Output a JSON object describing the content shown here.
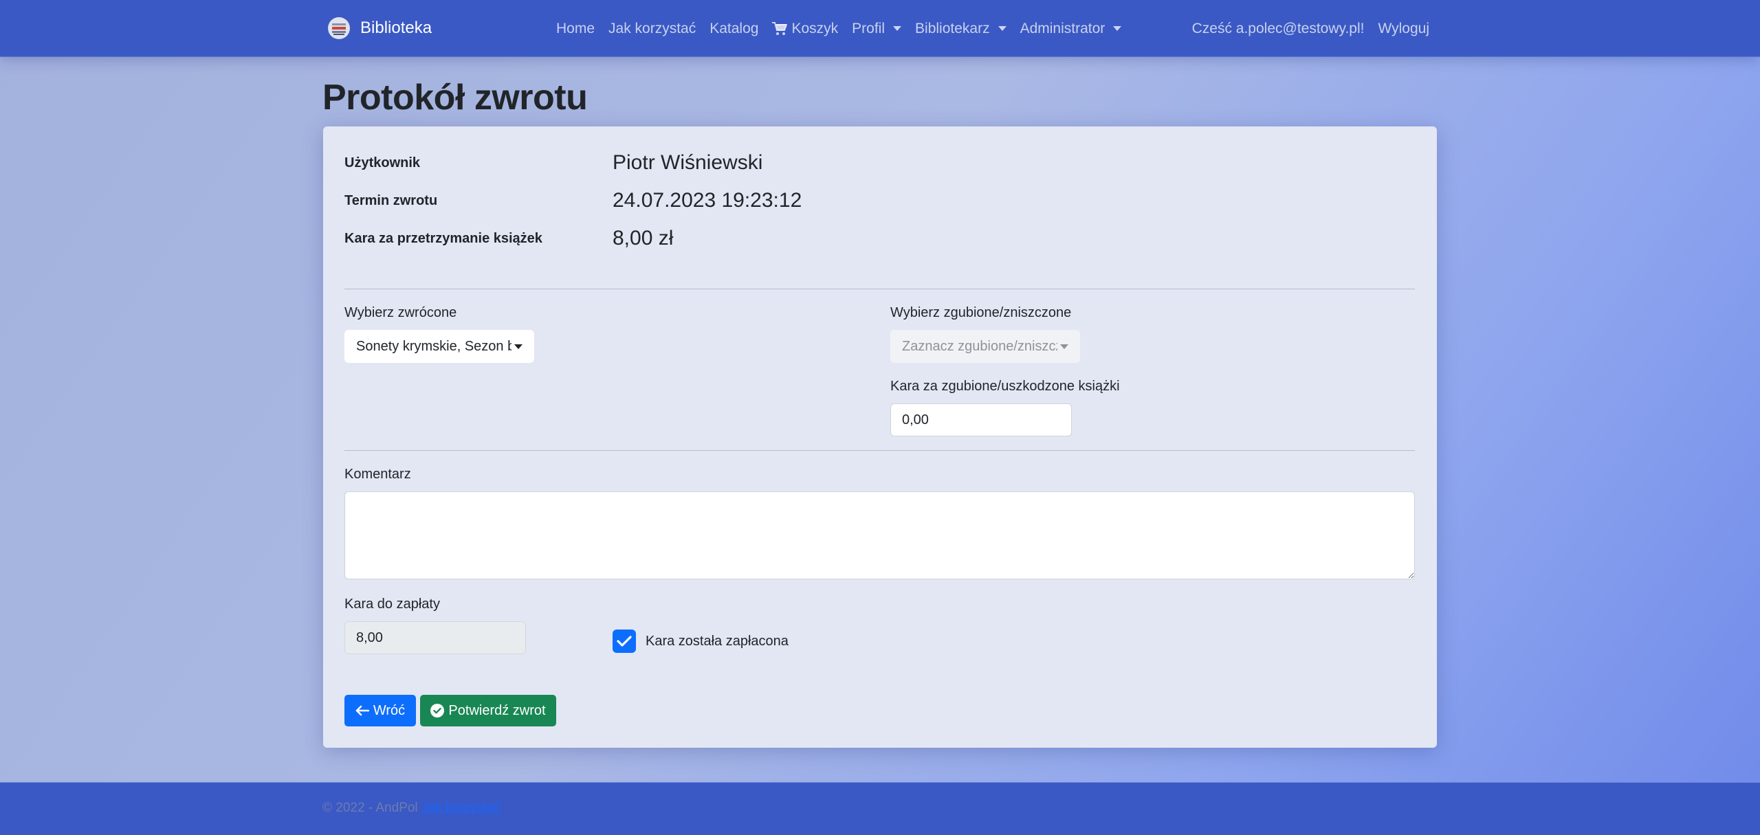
{
  "navbar": {
    "brand": "Biblioteka",
    "links": [
      {
        "label": "Home"
      },
      {
        "label": "Jak korzystać"
      },
      {
        "label": "Katalog"
      },
      {
        "label": "Koszyk",
        "icon": "cart-icon"
      },
      {
        "label": "Profil",
        "dropdown": true
      },
      {
        "label": "Bibliotekarz",
        "dropdown": true
      },
      {
        "label": "Administrator",
        "dropdown": true
      }
    ],
    "greeting": "Cześć a.polec@testowy.pl!",
    "logout": "Wyloguj"
  },
  "page": {
    "title": "Protokół zwrotu"
  },
  "info": {
    "user_label": "Użytkownik",
    "user_value": "Piotr Wiśniewski",
    "due_label": "Termin zwrotu",
    "due_value": "24.07.2023 19:23:12",
    "late_fee_label": "Kara za przetrzymanie książek",
    "late_fee_value": "8,00 zł"
  },
  "form": {
    "returned_label": "Wybierz zwrócone",
    "returned_value": "Sonety krymskie, Sezon b",
    "lost_label": "Wybierz zgubione/zniszczone",
    "lost_placeholder": "Zaznacz zgubione/zniszcz",
    "lost_fee_label": "Kara za zgubione/uszkodzone książki",
    "lost_fee_value": "0,00",
    "comment_label": "Komentarz",
    "comment_value": "",
    "total_label": "Kara do zapłaty",
    "total_value": "8,00",
    "paid_label": "Kara została zapłacona",
    "paid_checked": true
  },
  "buttons": {
    "back": "Wróć",
    "confirm": "Potwierdź zwrot"
  },
  "footer": {
    "text": "© 2022 - AndPol",
    "link": "Jak korzystać"
  },
  "colors": {
    "navbar": "#3a59c4",
    "primary": "#0d6efd",
    "success": "#198754",
    "card": "#e3e7f4"
  }
}
